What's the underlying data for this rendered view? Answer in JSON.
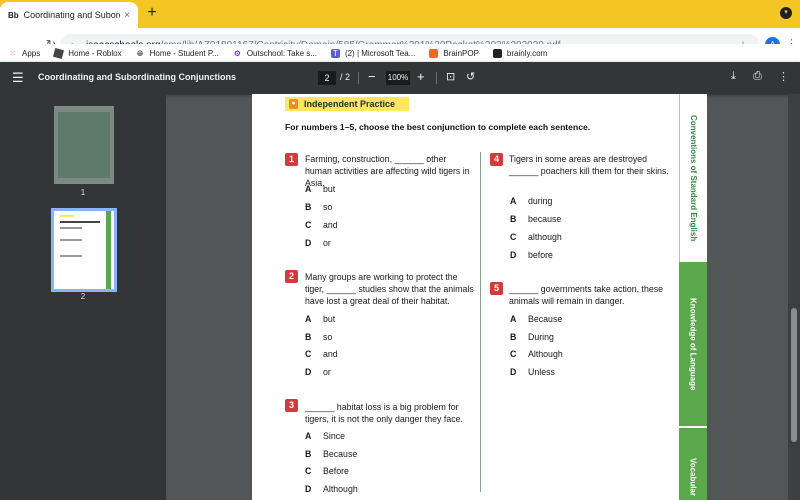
{
  "browser": {
    "tab": {
      "favicon": "Bb",
      "title": "Coordinating and Subordinating...",
      "close": "×"
    },
    "new_tab": "+",
    "address": {
      "host": "isaacschools.org",
      "path": "/cms/lib/AZ01801167/Centricity/Domain/585/Grammar%201%20Packet%203%202020.pdf"
    },
    "profile_initial": "A",
    "bookmarks": [
      {
        "icon": "apps-grid-icon",
        "label": "Apps"
      },
      {
        "icon": "roblox-icon",
        "label": "Home - Roblox"
      },
      {
        "icon": "globe-icon",
        "label": "Home - Student P..."
      },
      {
        "icon": "outschool-icon",
        "label": "Outschool: Take s..."
      },
      {
        "icon": "teams-icon",
        "label": "(2) | Microsoft Tea..."
      },
      {
        "icon": "brainpop-icon",
        "label": "BrainPOP"
      },
      {
        "icon": "brainly-icon",
        "label": "brainly.com"
      }
    ]
  },
  "pdf_toolbar": {
    "title": "Coordinating and Subordinating Conjunctions",
    "current_page": "2",
    "total_pages": "/ 2",
    "zoom": "100%"
  },
  "thumbnails": [
    {
      "label": "1"
    },
    {
      "label": "2"
    }
  ],
  "worksheet": {
    "banner": "Independent Practice",
    "instruction": "For numbers 1–5, choose the best conjunction to complete each sentence.",
    "questions": [
      {
        "num": "1",
        "text": "Farming, construction, ______ other human activities are affecting wild tigers in Asia.",
        "options": [
          {
            "letter": "A",
            "text": "but"
          },
          {
            "letter": "B",
            "text": "so"
          },
          {
            "letter": "C",
            "text": "and"
          },
          {
            "letter": "D",
            "text": "or"
          }
        ]
      },
      {
        "num": "2",
        "text": "Many groups are working to protect the tiger, ______ studies show that the animals have lost a great deal of their habitat.",
        "options": [
          {
            "letter": "A",
            "text": "but"
          },
          {
            "letter": "B",
            "text": "so"
          },
          {
            "letter": "C",
            "text": "and"
          },
          {
            "letter": "D",
            "text": "or"
          }
        ]
      },
      {
        "num": "3",
        "text": "______ habitat loss is a big problem for tigers, it is not the only danger they face.",
        "options": [
          {
            "letter": "A",
            "text": "Since"
          },
          {
            "letter": "B",
            "text": "Because"
          },
          {
            "letter": "C",
            "text": "Before"
          },
          {
            "letter": "D",
            "text": "Although"
          }
        ]
      },
      {
        "num": "4",
        "text": "Tigers in some areas are destroyed ______ poachers kill them for their skins.",
        "options": [
          {
            "letter": "A",
            "text": "during"
          },
          {
            "letter": "B",
            "text": "because"
          },
          {
            "letter": "C",
            "text": "although"
          },
          {
            "letter": "D",
            "text": "before"
          }
        ]
      },
      {
        "num": "5",
        "text": "______ governments take action, these animals will remain in danger.",
        "options": [
          {
            "letter": "A",
            "text": "Because"
          },
          {
            "letter": "B",
            "text": "During"
          },
          {
            "letter": "C",
            "text": "Although"
          },
          {
            "letter": "D",
            "text": "Unless"
          }
        ]
      }
    ],
    "side_tabs": [
      "Conventions of Standard English",
      "Knowledge of Language",
      "Vocabular"
    ]
  },
  "colors": {
    "tab_strip": "#f3c624",
    "question_badge": "#d23b3b",
    "side_tab_green": "#5aa84b",
    "banner_yellow": "#ffe75c"
  }
}
